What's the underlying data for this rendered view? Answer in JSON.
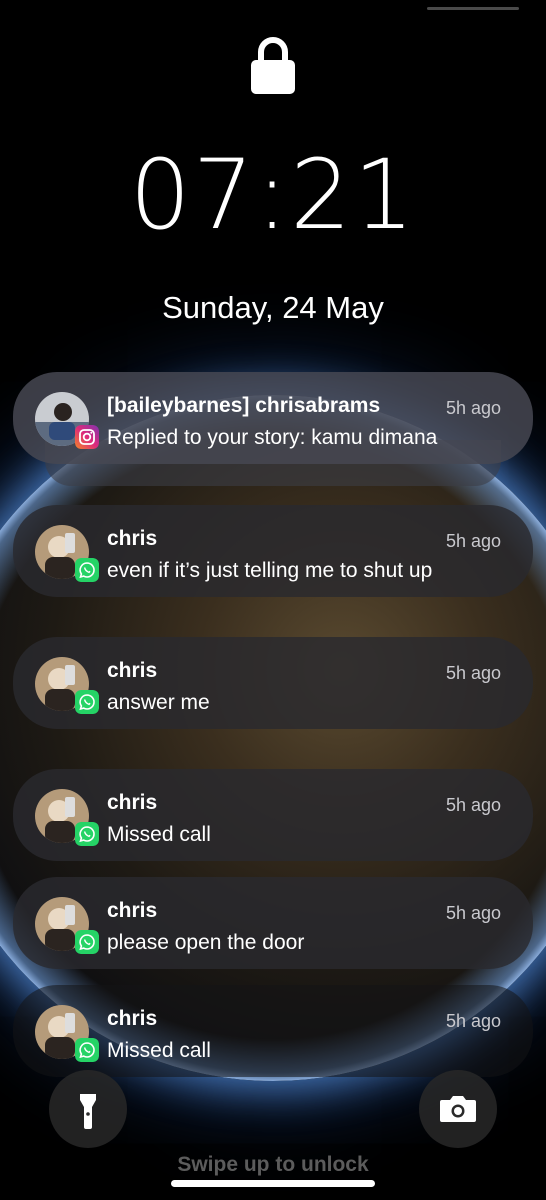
{
  "lock_screen": {
    "time": "07:21",
    "date": "Sunday, 24 May",
    "swipe_hint": "Swipe up to unlock"
  },
  "notifications": [
    {
      "sender": "[baileybarnes] chrisabrams",
      "message": "Replied to your story: kamu dimana",
      "time": "5h ago",
      "app": "instagram-icon"
    },
    {
      "sender": "chris",
      "message": "even if it’s just telling me to shut up",
      "time": "5h ago",
      "app": "whatsapp-icon"
    },
    {
      "sender": "chris",
      "message": "answer me",
      "time": "5h ago",
      "app": "whatsapp-icon"
    },
    {
      "sender": "chris",
      "message": "Missed call",
      "time": "5h ago",
      "app": "whatsapp-icon"
    },
    {
      "sender": "chris",
      "message": "please open the door",
      "time": "5h ago",
      "app": "whatsapp-icon"
    },
    {
      "sender": "chris",
      "message": "Missed call",
      "time": "5h ago",
      "app": "whatsapp-icon"
    }
  ],
  "controls": {
    "left": "flashlight-icon",
    "right": "camera-icon"
  },
  "colors": {
    "whatsapp": "#25D366",
    "instagram_start": "#F58529",
    "instagram_end": "#DD2A7B",
    "planet_glow": "#5A96E6"
  }
}
